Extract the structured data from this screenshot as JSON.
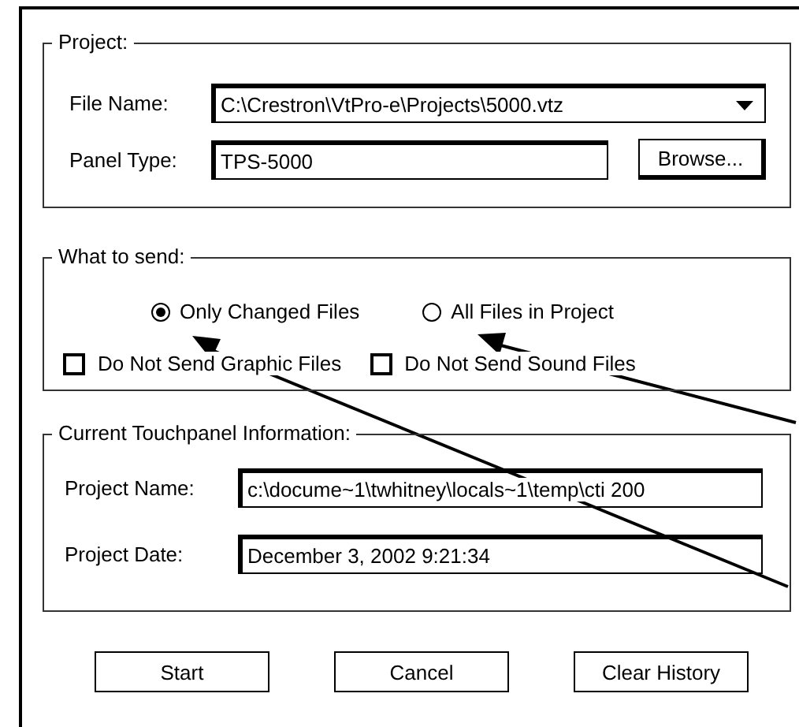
{
  "project": {
    "title": "Project:",
    "file_name": {
      "label": "File Name:",
      "value": "C:\\Crestron\\VtPro-e\\Projects\\5000.vtz"
    },
    "panel_type": {
      "label": "Panel Type:",
      "value": "TPS-5000"
    },
    "browse_button": "Browse..."
  },
  "what_to_send": {
    "title": "What to send:",
    "options": [
      {
        "label": "Only Changed Files",
        "selected": true
      },
      {
        "label": "All Files in Project",
        "selected": false
      }
    ],
    "checkboxes": [
      {
        "label": "Do Not Send Graphic Files",
        "checked": false
      },
      {
        "label": "Do Not Send Sound Files",
        "checked": false
      }
    ]
  },
  "touchpanel_info": {
    "title": "Current Touchpanel Information:",
    "fields": [
      {
        "label": "Project Name:",
        "value": "c:\\docume~1\\twhitney\\locals~1\\temp\\cti 200"
      },
      {
        "label": "Project Date:",
        "value": "December 3, 2002 9:21:34"
      }
    ]
  },
  "buttons": [
    "Start",
    "Cancel",
    "Clear History"
  ]
}
